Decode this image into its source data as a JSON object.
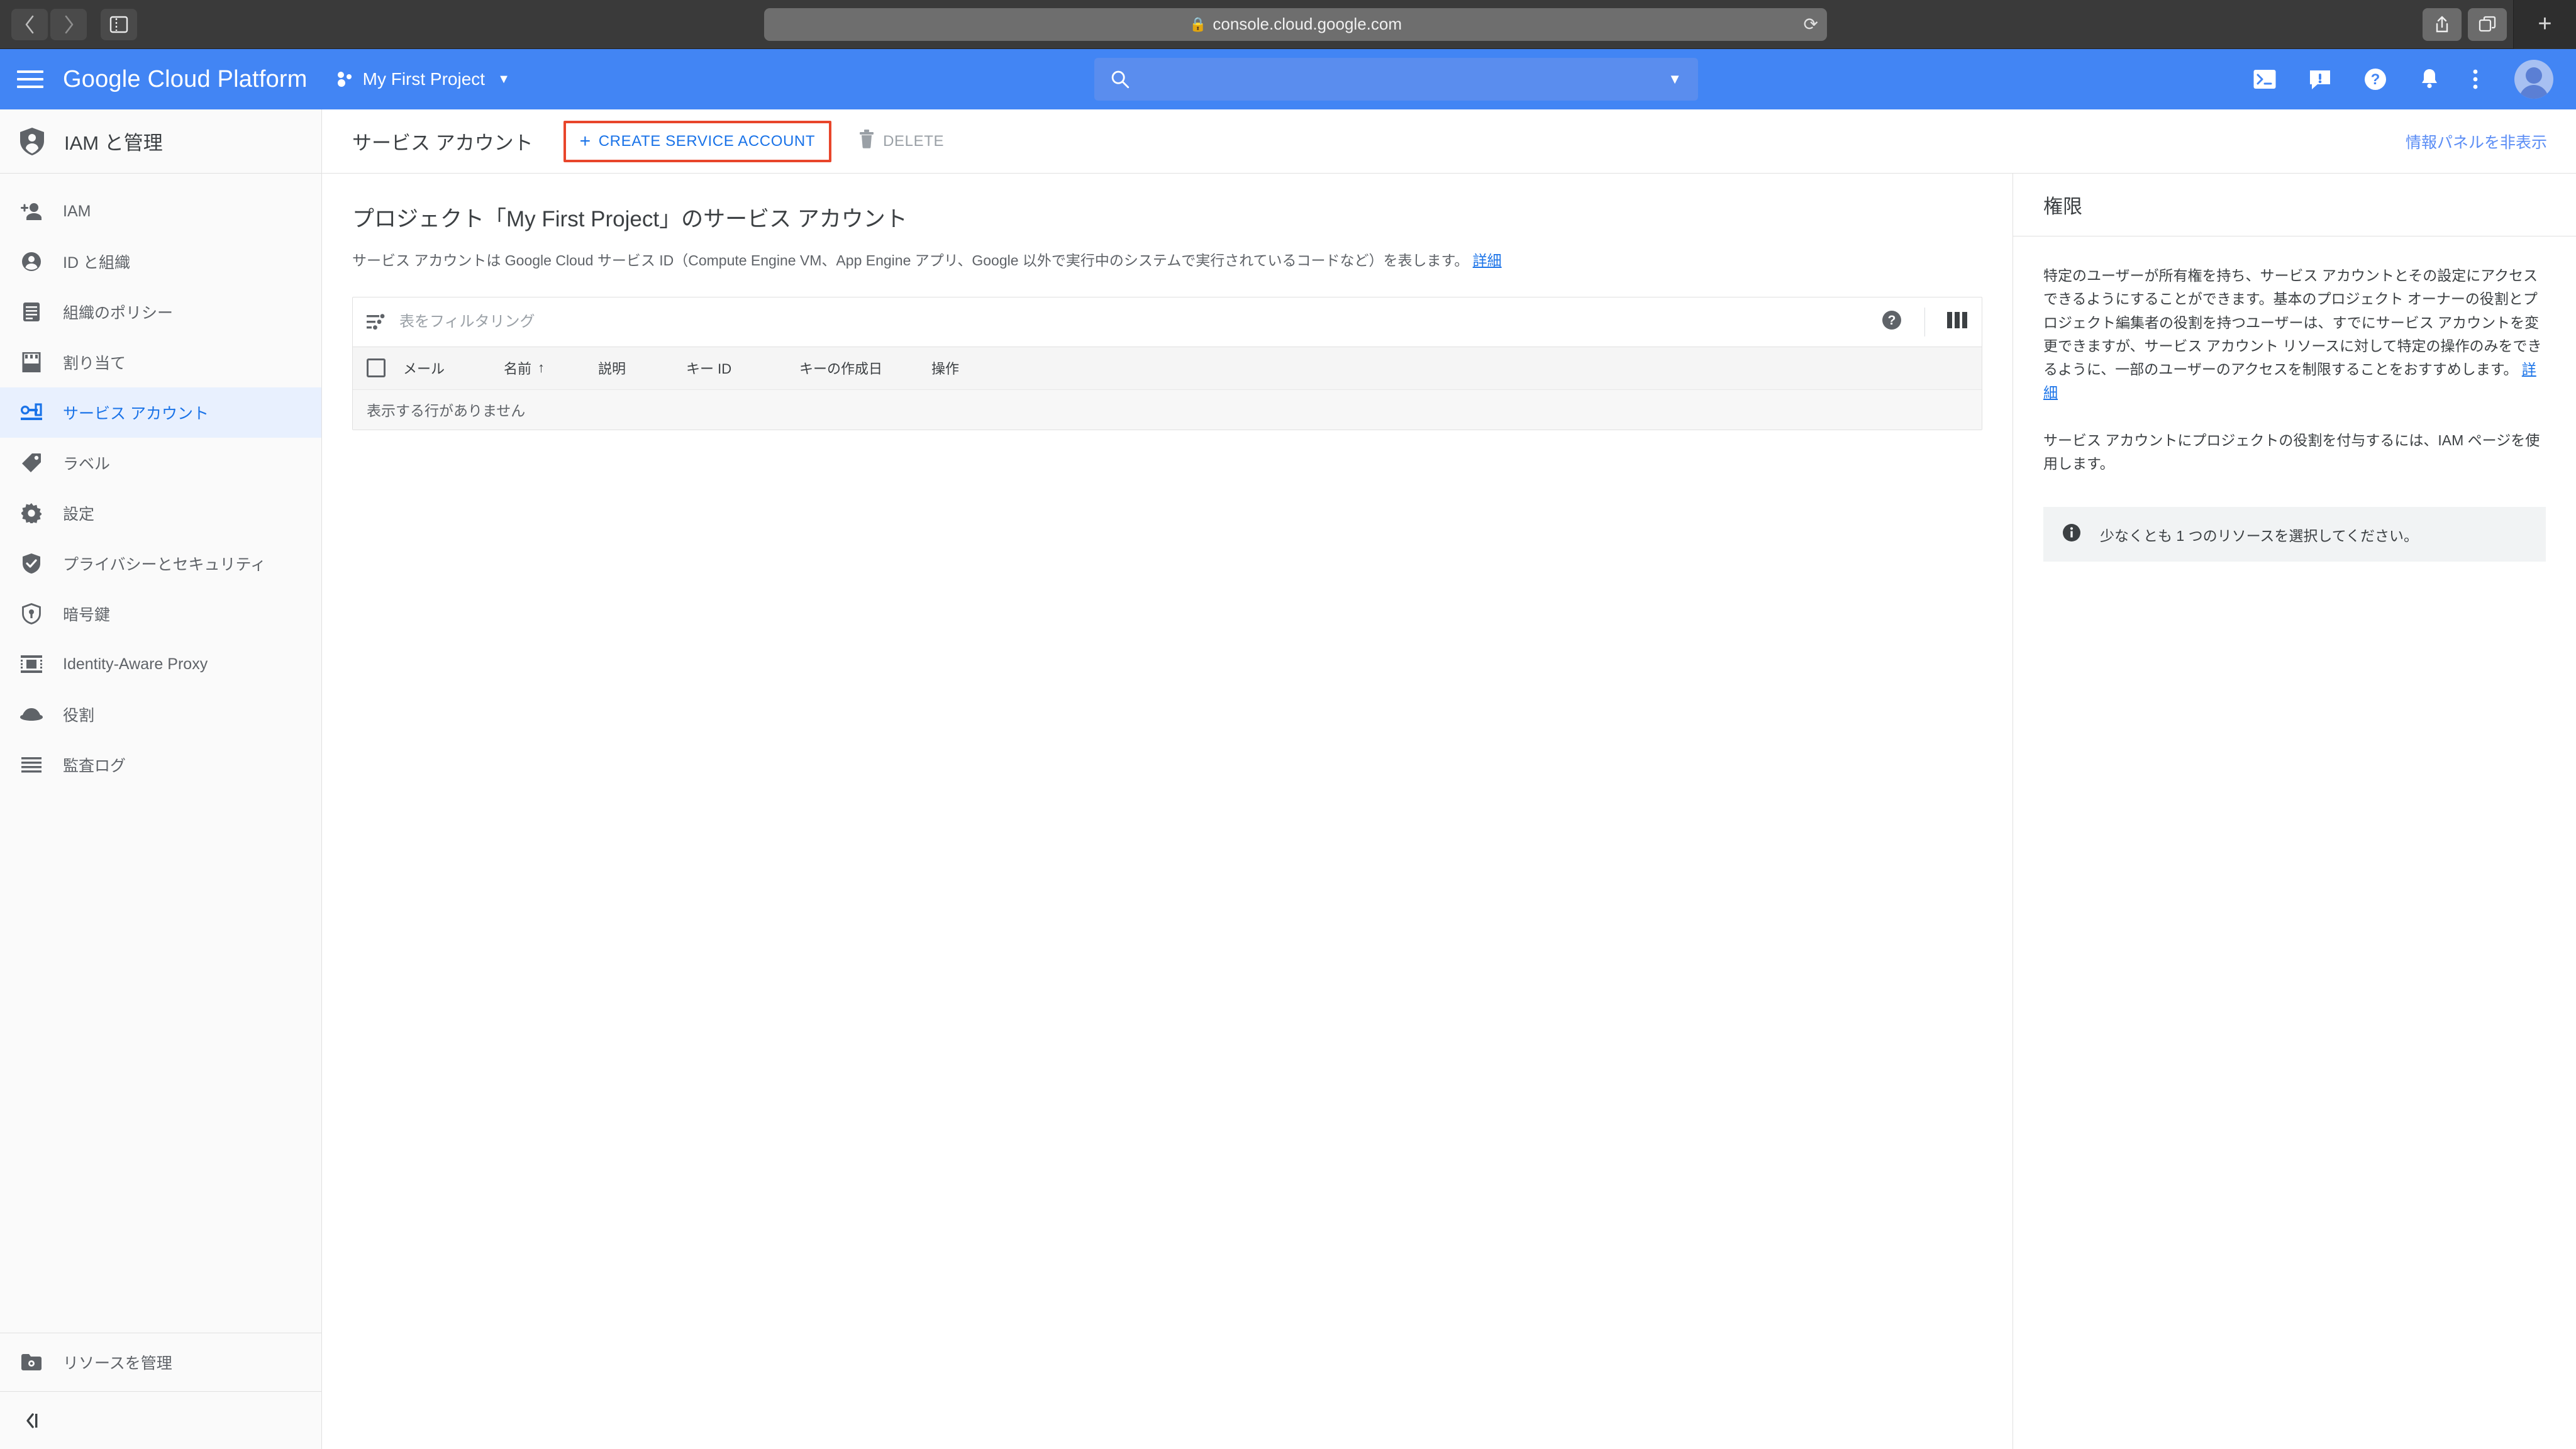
{
  "browser": {
    "back_icon": "back-chevron-icon",
    "forward_icon": "forward-chevron-icon",
    "sidebar_toggle_icon": "sidebar-toggle-icon",
    "url": "console.cloud.google.com",
    "lock_icon": "lock-icon",
    "reload_icon": "reload-icon",
    "share_icon": "share-icon",
    "tabs_icon": "tabs-overview-icon",
    "newtab_label": "+"
  },
  "header": {
    "menu_icon": "hamburger-menu-icon",
    "brand": "Google Cloud Platform",
    "project_name": "My First Project",
    "project_icon": "project-dots-icon",
    "caret": "▼",
    "search_placeholder": "",
    "search_icon": "search-icon",
    "search_caret": "▼",
    "actions": [
      {
        "name": "cloud-shell-icon"
      },
      {
        "name": "feedback-icon"
      },
      {
        "name": "help-icon"
      },
      {
        "name": "notifications-bell-icon"
      },
      {
        "name": "more-vert-icon"
      }
    ],
    "avatar_name": "user-avatar"
  },
  "sidebar": {
    "title": "IAM と管理",
    "title_icon": "shield-person-icon",
    "items": [
      {
        "label": "IAM",
        "icon": "person-add-icon",
        "active": false
      },
      {
        "label": "ID と組織",
        "icon": "account-circle-icon",
        "active": false
      },
      {
        "label": "組織のポリシー",
        "icon": "document-lines-icon",
        "active": false
      },
      {
        "label": "割り当て",
        "icon": "quota-icon",
        "active": false
      },
      {
        "label": "サービス アカウント",
        "icon": "key-card-icon",
        "active": true
      },
      {
        "label": "ラベル",
        "icon": "label-tag-icon",
        "active": false
      },
      {
        "label": "設定",
        "icon": "gear-icon",
        "active": false
      },
      {
        "label": "プライバシーとセキュリティ",
        "icon": "shield-check-icon",
        "active": false
      },
      {
        "label": "暗号鍵",
        "icon": "shield-key-icon",
        "active": false
      },
      {
        "label": "Identity-Aware Proxy",
        "icon": "iap-icon",
        "active": false
      },
      {
        "label": "役割",
        "icon": "roles-hat-icon",
        "active": false
      },
      {
        "label": "監査ログ",
        "icon": "audit-log-lines-icon",
        "active": false
      }
    ],
    "footer_item": {
      "label": "リソースを管理",
      "icon": "folder-settings-icon"
    },
    "collapse_icon": "collapse-panel-icon"
  },
  "toolbar": {
    "title": "サービス アカウント",
    "create_label": "CREATE SERVICE ACCOUNT",
    "create_plus": "+",
    "delete_label": "DELETE",
    "delete_icon": "trash-icon",
    "hide_panel_label": "情報パネルを非表示",
    "highlight_color": "#e8452b"
  },
  "content": {
    "heading": "プロジェクト「My First Project」のサービス アカウント",
    "description": "サービス アカウントは Google Cloud サービス ID（Compute Engine VM、App Engine アプリ、Google 以外で実行中のシステムで実行されているコードなど）を表します。",
    "description_link": "詳細",
    "filter_placeholder": "表をフィルタリング",
    "filter_icon": "filter-list-icon",
    "help_icon": "help-circle-icon",
    "columns_icon": "column-settings-icon",
    "table": {
      "select_all_checkbox": "select-all-checkbox",
      "columns": [
        {
          "label": "メール",
          "sorted": false
        },
        {
          "label": "名前",
          "sorted": true,
          "arrow": "↑"
        },
        {
          "label": "説明",
          "sorted": false
        },
        {
          "label": "キー ID",
          "sorted": false
        },
        {
          "label": "キーの作成日",
          "sorted": false
        },
        {
          "label": "操作",
          "sorted": false
        }
      ],
      "rows": [],
      "empty_text": "表示する行がありません"
    }
  },
  "info_panel": {
    "title": "権限",
    "paragraph1": "特定のユーザーが所有権を持ち、サービス アカウントとその設定にアクセスできるようにすることができます。基本のプロジェクト オーナーの役割とプロジェクト編集者の役割を持つユーザーは、すでにサービス アカウントを変更できますが、サービス アカウント リソースに対して特定の操作のみをできるように、一部のユーザーのアクセスを制限することをおすすめします。",
    "paragraph1_link": "詳細",
    "paragraph2": "サービス アカウントにプロジェクトの役割を付与するには、IAM ページを使用します。",
    "notice_text": "少なくとも 1 つのリソースを選択してください。",
    "notice_icon": "info-icon"
  },
  "colors": {
    "brand_blue": "#4285f4",
    "link_blue": "#1a73e8",
    "active_bg": "#e8f0fe",
    "highlight_red": "#e8452b"
  }
}
